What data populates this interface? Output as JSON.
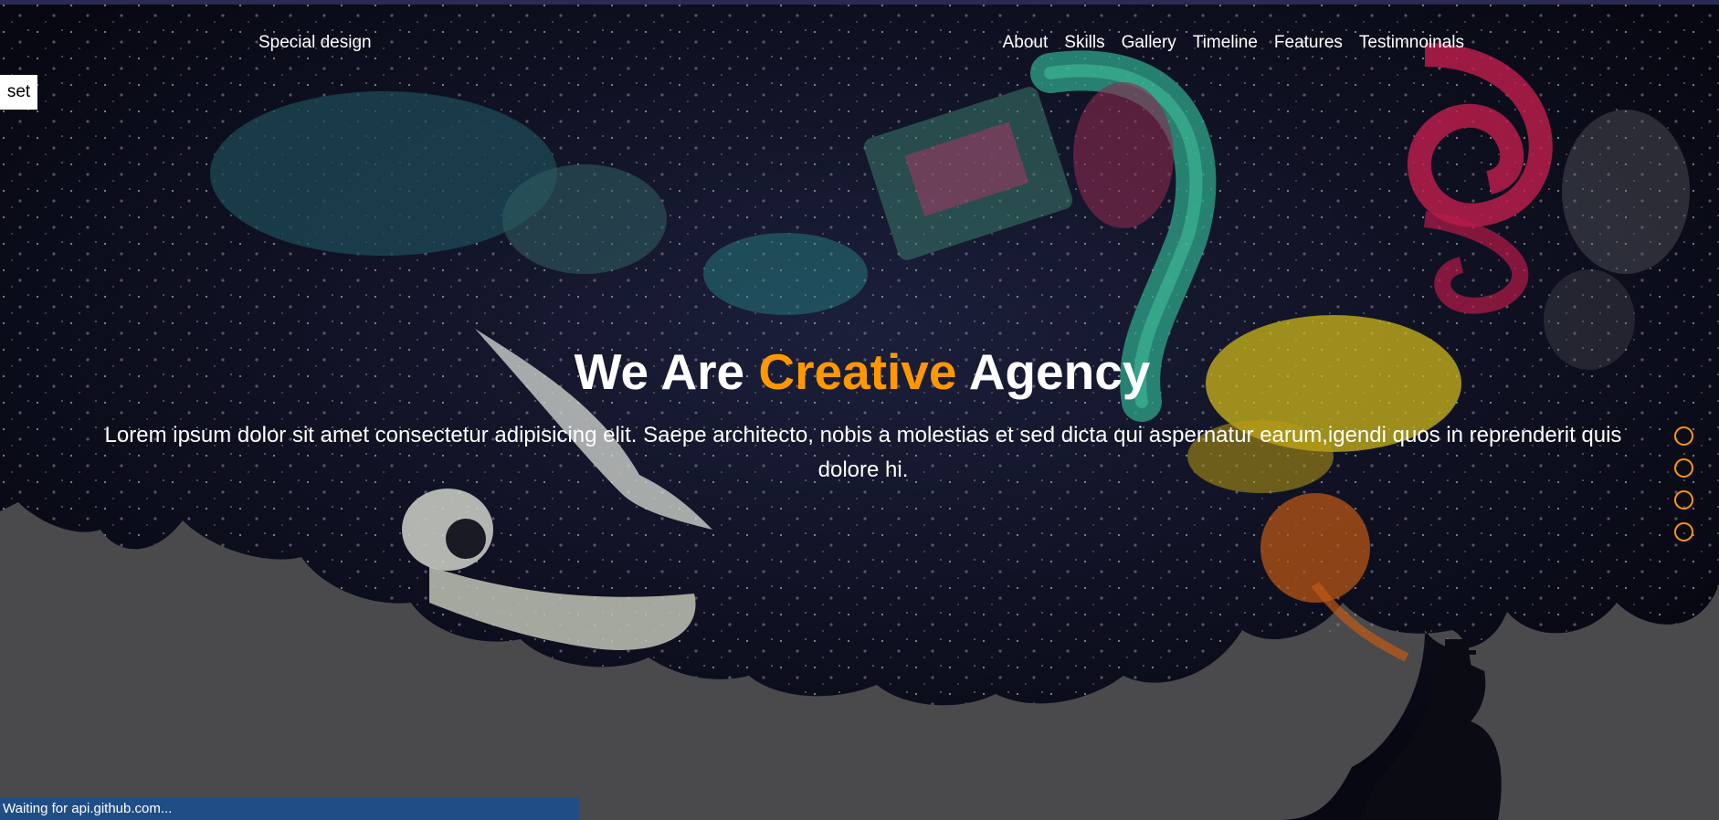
{
  "header": {
    "logo": "Special design",
    "nav": [
      "About",
      "Skills",
      "Gallery",
      "Timeline",
      "Features",
      "Testimnoinals"
    ]
  },
  "settings": {
    "toggle_label": "set"
  },
  "hero": {
    "title_prefix": "We Are",
    "title_highlight": "Creative",
    "title_suffix": "Agency",
    "description": "Lorem ipsum dolor sit amet consectetur adipisicing elit. Saepe architecto, nobis a molestias et sed dicta qui aspernatur earum,igendi quos in reprenderit quis dolore hi."
  },
  "bullets": {
    "count": 4,
    "color": "#ff9800"
  },
  "status_bar": {
    "text": "Waiting for api.github.com..."
  },
  "colors": {
    "accent": "#ff9800",
    "background": "#4a4a4c",
    "sky": "#0d0f1e",
    "status_bar": "#1f4e86"
  }
}
